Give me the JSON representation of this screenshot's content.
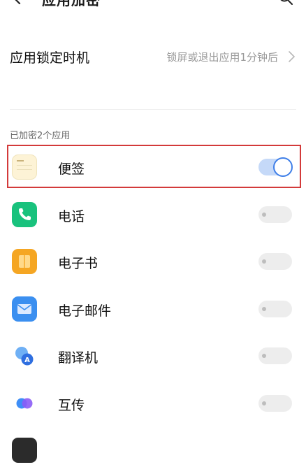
{
  "topbar": {
    "title": "应用加密"
  },
  "lock_setting": {
    "label": "应用锁定时机",
    "value": "锁屏或退出应用1分钟后"
  },
  "section": {
    "header": "已加密2个应用"
  },
  "apps": [
    {
      "name": "便签",
      "icon": "notes-icon",
      "enabled": true
    },
    {
      "name": "电话",
      "icon": "phone-icon",
      "enabled": false
    },
    {
      "name": "电子书",
      "icon": "ebook-icon",
      "enabled": false
    },
    {
      "name": "电子邮件",
      "icon": "email-icon",
      "enabled": false
    },
    {
      "name": "翻译机",
      "icon": "translator-icon",
      "enabled": false
    },
    {
      "name": "互传",
      "icon": "share-icon",
      "enabled": false
    }
  ],
  "colors": {
    "accent": "#3f7fe8",
    "highlight": "#d33a3a",
    "toggle_off": "#ededed"
  }
}
